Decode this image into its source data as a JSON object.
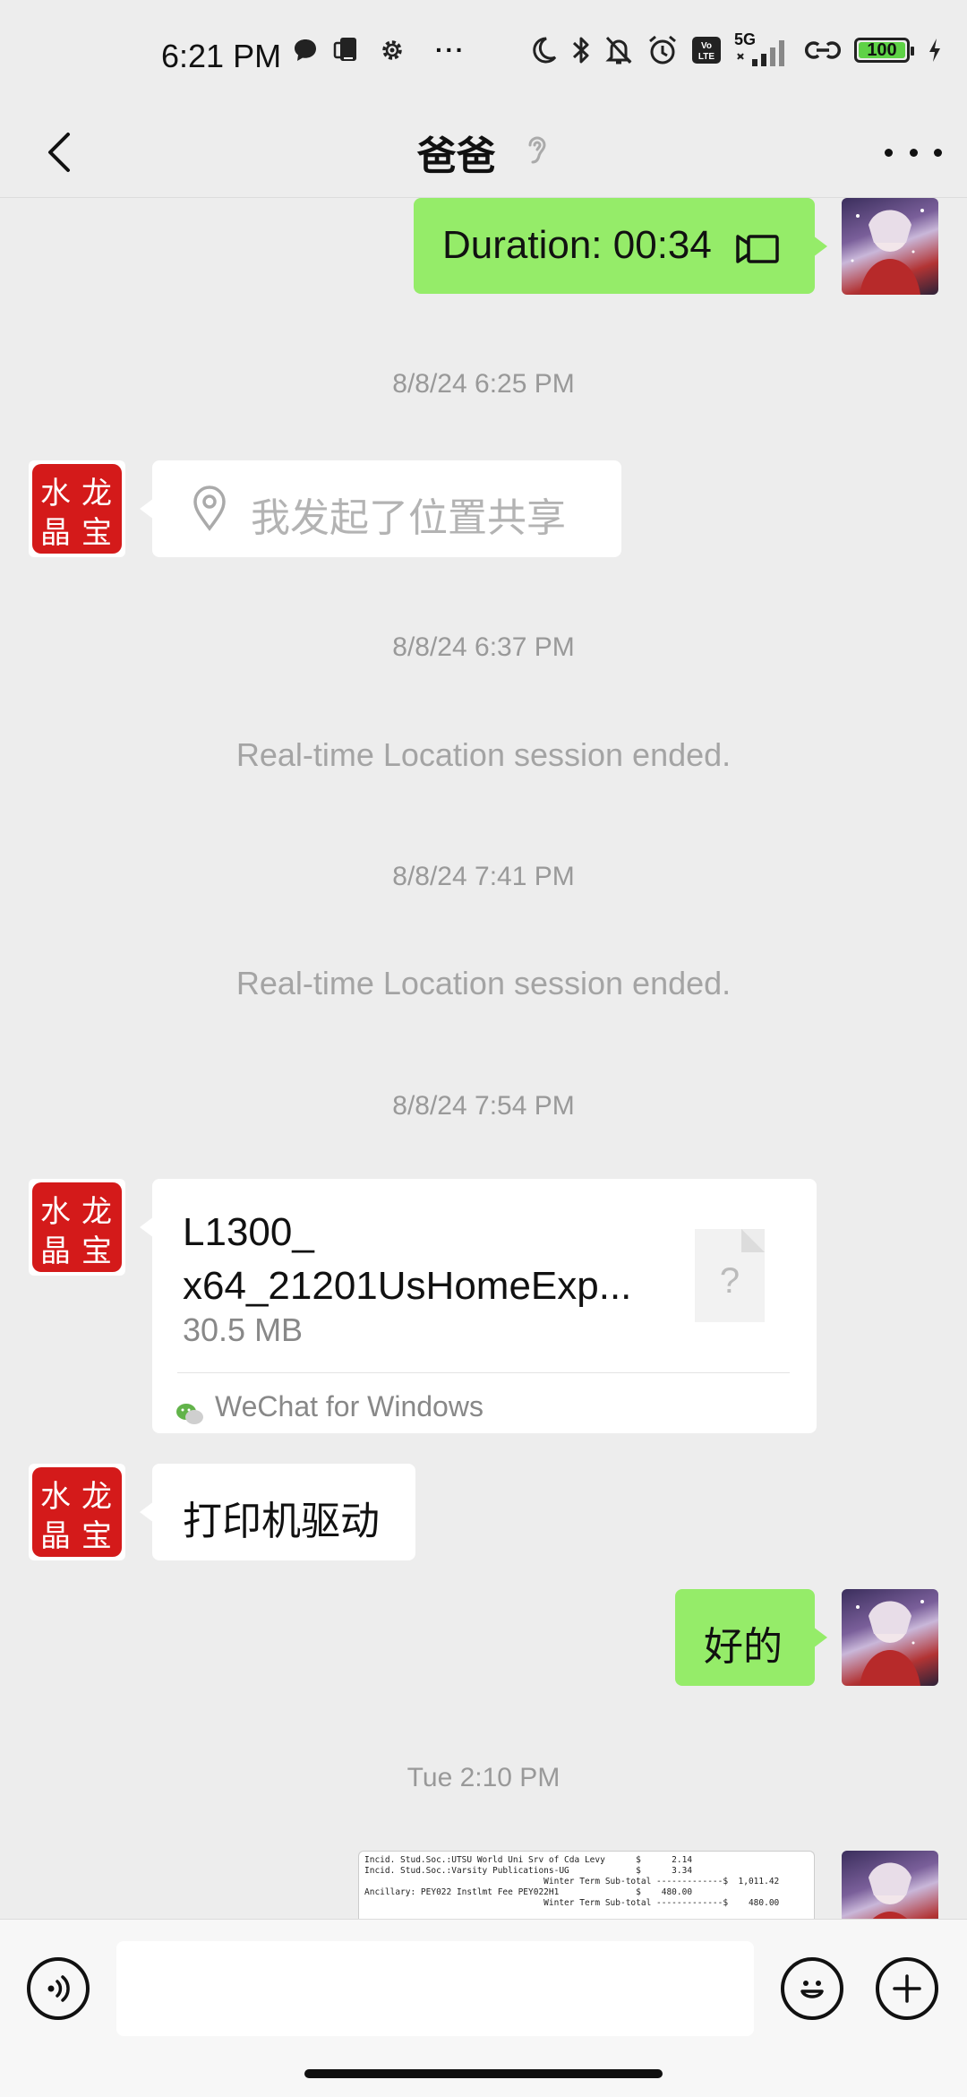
{
  "status_bar": {
    "time": "6:21 PM",
    "more": "···",
    "network": "5G",
    "battery": "100"
  },
  "header": {
    "title": "爸爸"
  },
  "messages": {
    "call": {
      "label": "Duration: 00:34"
    },
    "ts1": "8/8/24 6:25 PM",
    "location": {
      "text": "我发起了位置共享"
    },
    "ts2": "8/8/24 6:37 PM",
    "sys1": "Real-time Location session ended.",
    "ts3": "8/8/24 7:41 PM",
    "sys2": "Real-time Location session ended.",
    "ts4": "8/8/24 7:54 PM",
    "file": {
      "name": "L1300_ x64_21201UsHomeExp...",
      "size": "30.5 MB",
      "icon_char": "?",
      "source": "WeChat for Windows"
    },
    "text1": "打印机驱动",
    "text2": "好的",
    "ts5": "Tue 2:10 PM",
    "receipt_lines": [
      "Incid. Stud.Soc.:UTSU World Uni Srv of Cda Levy      $      2.14",
      "Incid. Stud.Soc.:Varsity Publications-UG             $      3.34",
      "                                   Winter Term Sub-total -------------$  1,011.42",
      "Ancillary: PEY022 Instlmt Fee PEY022H1               $    480.00",
      "                                   Winter Term Sub-total -------------$    480.00"
    ]
  },
  "left_avatar": {
    "chars": [
      "水",
      "龙",
      "晶",
      "宝"
    ]
  },
  "colors": {
    "bg": "#ededed",
    "green_bubble": "#95ec69",
    "white_bubble": "#ffffff",
    "stamp_red": "#d41a1a",
    "battery_green": "#5ed246"
  },
  "input": {
    "value": "",
    "placeholder": ""
  },
  "icons": [
    "back-icon",
    "ear-icon",
    "more-icon",
    "video-call-icon",
    "location-pin-icon",
    "file-unknown-icon",
    "wechat-icon",
    "voice-icon",
    "emoji-icon",
    "plus-icon"
  ]
}
